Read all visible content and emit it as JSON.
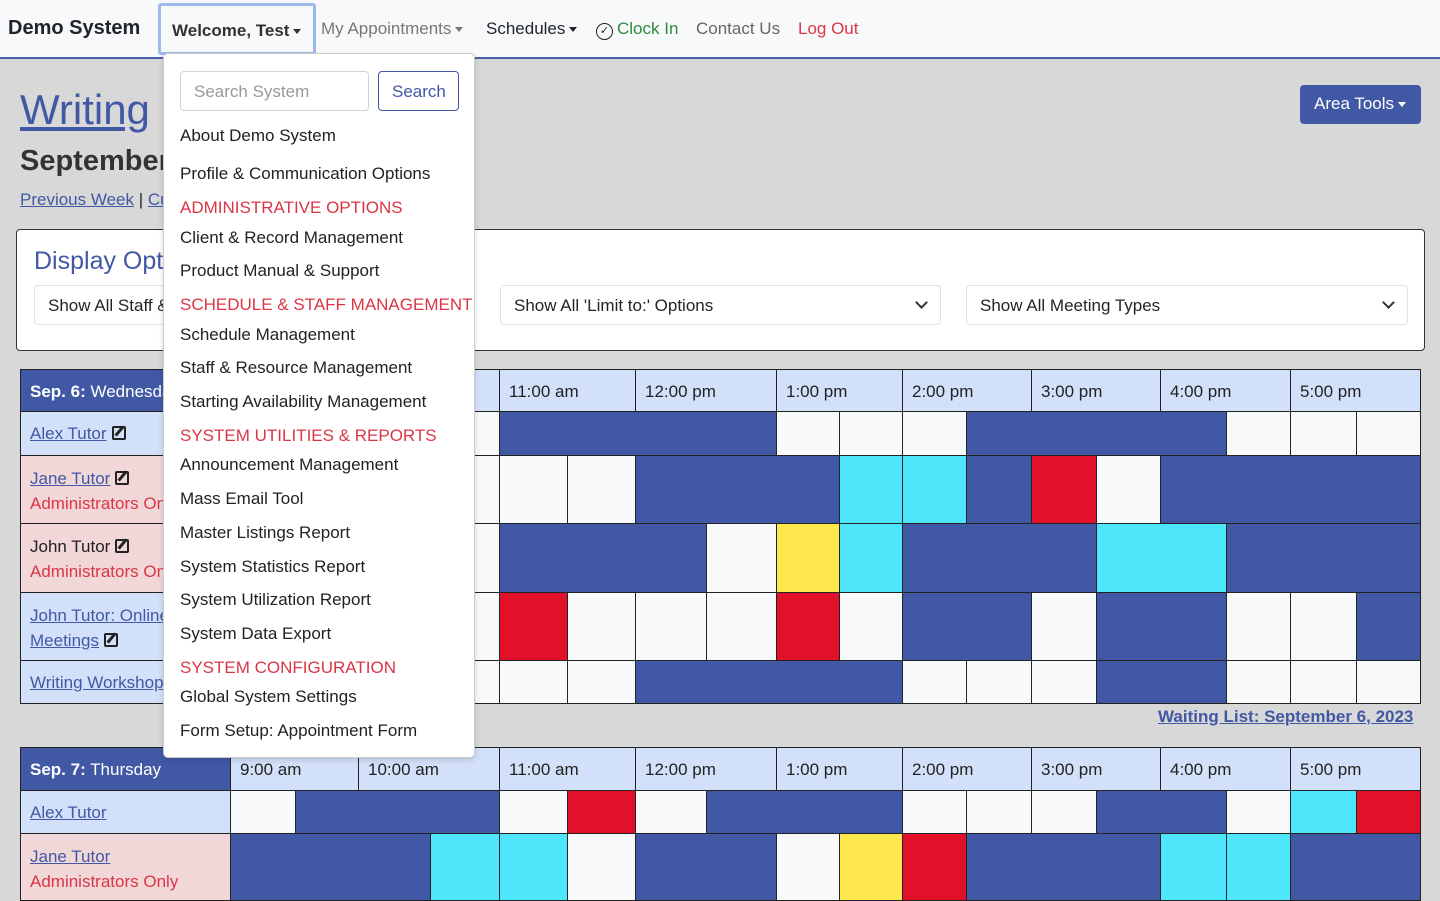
{
  "navbar": {
    "brand": "Demo System",
    "welcome": "Welcome, Test",
    "appointments": "My Appointments",
    "schedules": "Schedules",
    "clock_in": "Clock In",
    "contact": "Contact Us",
    "logout": "Log Out"
  },
  "page": {
    "title": "Writing",
    "subtitle": "September",
    "prev_week": "Previous Week",
    "sep": " | ",
    "current": "Cu",
    "area_tools": "Area Tools"
  },
  "display_options": {
    "title": "Display Opt",
    "staff_select": "Show All Staff &",
    "limit_select": "Show All 'Limit to:' Options",
    "meeting_select": "Show All Meeting Types"
  },
  "dropdown": {
    "search_placeholder": "Search System",
    "search_button": "Search",
    "items": [
      {
        "label": "About Demo System",
        "type": "item"
      },
      {
        "label": "Profile & Communication Options",
        "type": "item"
      },
      {
        "label": "ADMINISTRATIVE OPTIONS",
        "type": "section"
      },
      {
        "label": "Client & Record Management",
        "type": "item"
      },
      {
        "label": "Product Manual & Support",
        "type": "item"
      },
      {
        "label": "SCHEDULE & STAFF MANAGEMENT",
        "type": "section"
      },
      {
        "label": "Schedule Management",
        "type": "item"
      },
      {
        "label": "Staff & Resource Management",
        "type": "item"
      },
      {
        "label": "Starting Availability Management",
        "type": "item"
      },
      {
        "label": "SYSTEM UTILITIES & REPORTS",
        "type": "section"
      },
      {
        "label": "Announcement Management",
        "type": "item"
      },
      {
        "label": "Mass Email Tool",
        "type": "item"
      },
      {
        "label": "Master Listings Report",
        "type": "item"
      },
      {
        "label": "System Statistics Report",
        "type": "item"
      },
      {
        "label": "System Utilization Report",
        "type": "item"
      },
      {
        "label": "System Data Export",
        "type": "item"
      },
      {
        "label": "SYSTEM CONFIGURATION",
        "type": "section"
      },
      {
        "label": "Global System Settings",
        "type": "item"
      },
      {
        "label": "Form Setup: Appointment Form",
        "type": "item"
      }
    ]
  },
  "colors": {
    "b": "#4158a5",
    "w": "#f8f9fa",
    "c": "#4de6fb",
    "r": "#e01128",
    "y": "#ffe84d",
    "accent": "#4158a5"
  },
  "times": [
    "9:00 am",
    "10:00 am",
    "11:00 am",
    "12:00 pm",
    "1:00 pm",
    "2:00 pm",
    "3:00 pm",
    "4:00 pm",
    "5:00 pm"
  ],
  "days": [
    {
      "date": "Sep. 6:",
      "weekday": "Wednesday",
      "waiting_list": "Waiting List: September 6, 2023",
      "rows": [
        {
          "name": "Alex Tutor",
          "editable": true,
          "admin": "",
          "runs": [
            [
              "w",
              1
            ],
            [
              "w",
              1
            ],
            [
              "w",
              1
            ],
            [
              "w",
              1
            ],
            [
              "b",
              4
            ],
            [
              "w",
              1
            ],
            [
              "w",
              1
            ],
            [
              "w",
              1
            ],
            [
              "b",
              4
            ],
            [
              "w",
              1
            ],
            [
              "w",
              1
            ],
            [
              "w",
              1
            ]
          ]
        },
        {
          "name": "Jane Tutor",
          "editable": true,
          "admin": "Administrators Only",
          "runs": [
            [
              "w",
              1
            ],
            [
              "w",
              1
            ],
            [
              "w",
              1
            ],
            [
              "w",
              1
            ],
            [
              "w",
              1
            ],
            [
              "w",
              1
            ],
            [
              "b",
              3
            ],
            [
              "c",
              1
            ],
            [
              "c",
              1
            ],
            [
              "b",
              1
            ],
            [
              "r",
              1
            ],
            [
              "w",
              1
            ],
            [
              "b",
              4
            ]
          ]
        },
        {
          "name": "John Tutor",
          "editable": true,
          "admin": "Administrators Only",
          "plain": true,
          "runs": [
            [
              "w",
              1
            ],
            [
              "w",
              1
            ],
            [
              "w",
              1
            ],
            [
              "w",
              1
            ],
            [
              "b",
              3
            ],
            [
              "w",
              1
            ],
            [
              "y",
              1
            ],
            [
              "c",
              1
            ],
            [
              "b",
              3
            ],
            [
              "c",
              2
            ],
            [
              "b",
              3
            ]
          ]
        },
        {
          "name": "John Tutor: Online",
          "name2": "Meetings",
          "editable": true,
          "admin": "",
          "runs": [
            [
              "w",
              1
            ],
            [
              "w",
              1
            ],
            [
              "w",
              1
            ],
            [
              "w",
              1
            ],
            [
              "r",
              1
            ],
            [
              "w",
              1
            ],
            [
              "w",
              1
            ],
            [
              "w",
              1
            ],
            [
              "r",
              1
            ],
            [
              "w",
              1
            ],
            [
              "b",
              2
            ],
            [
              "w",
              1
            ],
            [
              "b",
              2
            ],
            [
              "w",
              1
            ],
            [
              "w",
              1
            ],
            [
              "b",
              1
            ]
          ]
        },
        {
          "name": "Writing Workshop",
          "editable": false,
          "admin": "",
          "runs": [
            [
              "w",
              1
            ],
            [
              "w",
              1
            ],
            [
              "w",
              1
            ],
            [
              "w",
              1
            ],
            [
              "w",
              1
            ],
            [
              "w",
              1
            ],
            [
              "b",
              4
            ],
            [
              "w",
              1
            ],
            [
              "w",
              1
            ],
            [
              "w",
              1
            ],
            [
              "b",
              2
            ],
            [
              "w",
              1
            ],
            [
              "w",
              1
            ],
            [
              "w",
              1
            ]
          ]
        }
      ]
    },
    {
      "date": "Sep. 7:",
      "weekday": "Thursday",
      "rows": [
        {
          "name": "Alex Tutor",
          "editable": false,
          "admin": "",
          "runs": [
            [
              "w",
              1
            ],
            [
              "b",
              3
            ],
            [
              "w",
              1
            ],
            [
              "r",
              1
            ],
            [
              "w",
              1
            ],
            [
              "b",
              3
            ],
            [
              "w",
              1
            ],
            [
              "w",
              1
            ],
            [
              "w",
              1
            ],
            [
              "b",
              2
            ],
            [
              "w",
              1
            ],
            [
              "c",
              1
            ],
            [
              "r",
              1
            ]
          ]
        },
        {
          "name": "Jane Tutor",
          "editable": false,
          "admin": "Administrators Only",
          "runs": [
            [
              "b",
              3
            ],
            [
              "c",
              1
            ],
            [
              "c",
              1
            ],
            [
              "w",
              1
            ],
            [
              "b",
              2
            ],
            [
              "w",
              1
            ],
            [
              "y",
              1
            ],
            [
              "r",
              1
            ],
            [
              "b",
              3
            ],
            [
              "c",
              1
            ],
            [
              "c",
              1
            ],
            [
              "b",
              2
            ]
          ]
        }
      ]
    }
  ]
}
